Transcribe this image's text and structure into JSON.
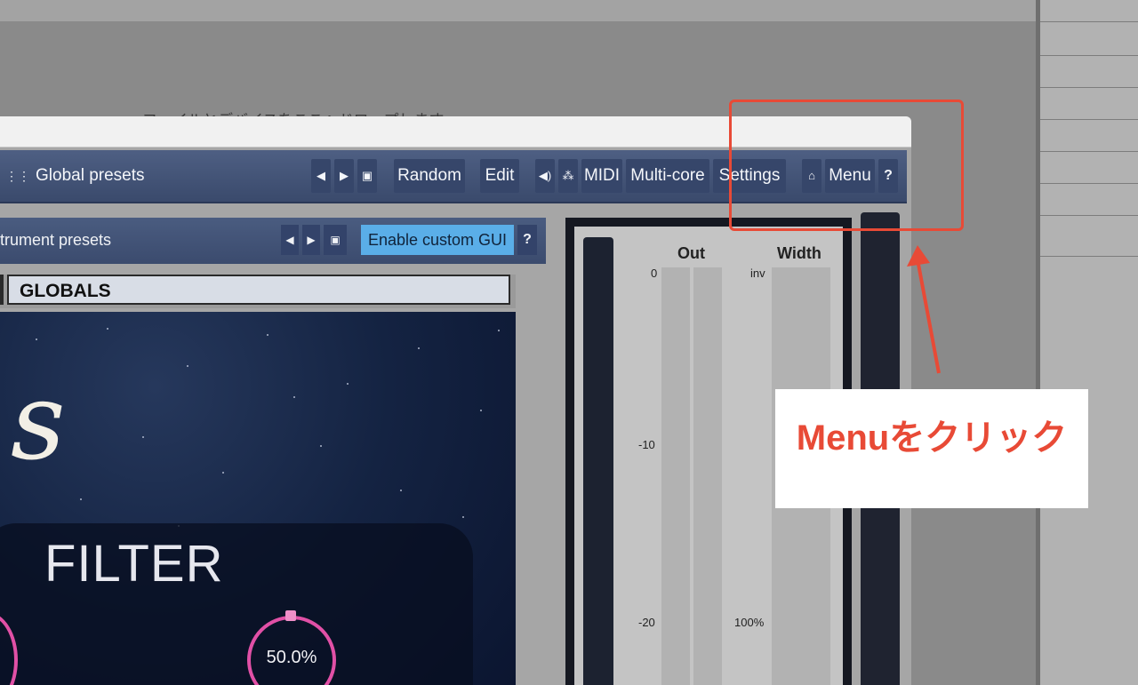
{
  "host": {
    "drop_hint": "ファイルとデバイスをここへドロップします"
  },
  "toolbar": {
    "global_presets_label": "Global presets",
    "prev_label": "◀",
    "next_label": "▶",
    "random_label": "Random",
    "edit_label": "Edit",
    "midi_label": "MIDI",
    "multicore_label": "Multi-core",
    "settings_label": "Settings",
    "menu_label": "Menu",
    "help_label": "?"
  },
  "instrument_bar": {
    "presets_label": "trument presets",
    "enable_custom_gui_label": "Enable custom GUI",
    "help_label": "?"
  },
  "tabs": {
    "globals_label": "GLOBALS"
  },
  "custom_gui": {
    "logo_glyph": "s",
    "filter_title": "FILTER",
    "knob_right_value": "50.0%"
  },
  "meter": {
    "out_label": "Out",
    "width_label": "Width",
    "ticks_left": [
      "0",
      "-10",
      "-20"
    ],
    "ticks_right": [
      "inv",
      "100%"
    ]
  },
  "annotation": {
    "callout_text": "Menuをクリック",
    "color": "#e84a36"
  }
}
